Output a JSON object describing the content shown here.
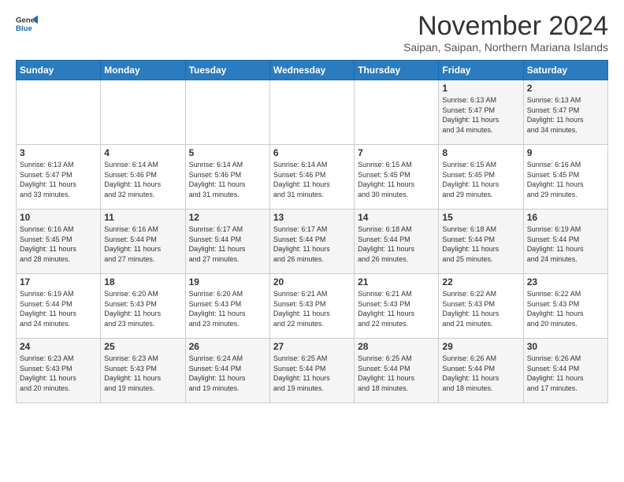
{
  "logo": {
    "line1": "General",
    "line2": "Blue"
  },
  "title": "November 2024",
  "subtitle": "Saipan, Saipan, Northern Mariana Islands",
  "days_of_week": [
    "Sunday",
    "Monday",
    "Tuesday",
    "Wednesday",
    "Thursday",
    "Friday",
    "Saturday"
  ],
  "weeks": [
    [
      {
        "day": "",
        "info": ""
      },
      {
        "day": "",
        "info": ""
      },
      {
        "day": "",
        "info": ""
      },
      {
        "day": "",
        "info": ""
      },
      {
        "day": "",
        "info": ""
      },
      {
        "day": "1",
        "info": "Sunrise: 6:13 AM\nSunset: 5:47 PM\nDaylight: 11 hours\nand 34 minutes."
      },
      {
        "day": "2",
        "info": "Sunrise: 6:13 AM\nSunset: 5:47 PM\nDaylight: 11 hours\nand 34 minutes."
      }
    ],
    [
      {
        "day": "3",
        "info": "Sunrise: 6:13 AM\nSunset: 5:47 PM\nDaylight: 11 hours\nand 33 minutes."
      },
      {
        "day": "4",
        "info": "Sunrise: 6:14 AM\nSunset: 5:46 PM\nDaylight: 11 hours\nand 32 minutes."
      },
      {
        "day": "5",
        "info": "Sunrise: 6:14 AM\nSunset: 5:46 PM\nDaylight: 11 hours\nand 31 minutes."
      },
      {
        "day": "6",
        "info": "Sunrise: 6:14 AM\nSunset: 5:46 PM\nDaylight: 11 hours\nand 31 minutes."
      },
      {
        "day": "7",
        "info": "Sunrise: 6:15 AM\nSunset: 5:45 PM\nDaylight: 11 hours\nand 30 minutes."
      },
      {
        "day": "8",
        "info": "Sunrise: 6:15 AM\nSunset: 5:45 PM\nDaylight: 11 hours\nand 29 minutes."
      },
      {
        "day": "9",
        "info": "Sunrise: 6:16 AM\nSunset: 5:45 PM\nDaylight: 11 hours\nand 29 minutes."
      }
    ],
    [
      {
        "day": "10",
        "info": "Sunrise: 6:16 AM\nSunset: 5:45 PM\nDaylight: 11 hours\nand 28 minutes."
      },
      {
        "day": "11",
        "info": "Sunrise: 6:16 AM\nSunset: 5:44 PM\nDaylight: 11 hours\nand 27 minutes."
      },
      {
        "day": "12",
        "info": "Sunrise: 6:17 AM\nSunset: 5:44 PM\nDaylight: 11 hours\nand 27 minutes."
      },
      {
        "day": "13",
        "info": "Sunrise: 6:17 AM\nSunset: 5:44 PM\nDaylight: 11 hours\nand 26 minutes."
      },
      {
        "day": "14",
        "info": "Sunrise: 6:18 AM\nSunset: 5:44 PM\nDaylight: 11 hours\nand 26 minutes."
      },
      {
        "day": "15",
        "info": "Sunrise: 6:18 AM\nSunset: 5:44 PM\nDaylight: 11 hours\nand 25 minutes."
      },
      {
        "day": "16",
        "info": "Sunrise: 6:19 AM\nSunset: 5:44 PM\nDaylight: 11 hours\nand 24 minutes."
      }
    ],
    [
      {
        "day": "17",
        "info": "Sunrise: 6:19 AM\nSunset: 5:44 PM\nDaylight: 11 hours\nand 24 minutes."
      },
      {
        "day": "18",
        "info": "Sunrise: 6:20 AM\nSunset: 5:43 PM\nDaylight: 11 hours\nand 23 minutes."
      },
      {
        "day": "19",
        "info": "Sunrise: 6:20 AM\nSunset: 5:43 PM\nDaylight: 11 hours\nand 23 minutes."
      },
      {
        "day": "20",
        "info": "Sunrise: 6:21 AM\nSunset: 5:43 PM\nDaylight: 11 hours\nand 22 minutes."
      },
      {
        "day": "21",
        "info": "Sunrise: 6:21 AM\nSunset: 5:43 PM\nDaylight: 11 hours\nand 22 minutes."
      },
      {
        "day": "22",
        "info": "Sunrise: 6:22 AM\nSunset: 5:43 PM\nDaylight: 11 hours\nand 21 minutes."
      },
      {
        "day": "23",
        "info": "Sunrise: 6:22 AM\nSunset: 5:43 PM\nDaylight: 11 hours\nand 20 minutes."
      }
    ],
    [
      {
        "day": "24",
        "info": "Sunrise: 6:23 AM\nSunset: 5:43 PM\nDaylight: 11 hours\nand 20 minutes."
      },
      {
        "day": "25",
        "info": "Sunrise: 6:23 AM\nSunset: 5:43 PM\nDaylight: 11 hours\nand 19 minutes."
      },
      {
        "day": "26",
        "info": "Sunrise: 6:24 AM\nSunset: 5:44 PM\nDaylight: 11 hours\nand 19 minutes."
      },
      {
        "day": "27",
        "info": "Sunrise: 6:25 AM\nSunset: 5:44 PM\nDaylight: 11 hours\nand 19 minutes."
      },
      {
        "day": "28",
        "info": "Sunrise: 6:25 AM\nSunset: 5:44 PM\nDaylight: 11 hours\nand 18 minutes."
      },
      {
        "day": "29",
        "info": "Sunrise: 6:26 AM\nSunset: 5:44 PM\nDaylight: 11 hours\nand 18 minutes."
      },
      {
        "day": "30",
        "info": "Sunrise: 6:26 AM\nSunset: 5:44 PM\nDaylight: 11 hours\nand 17 minutes."
      }
    ]
  ]
}
